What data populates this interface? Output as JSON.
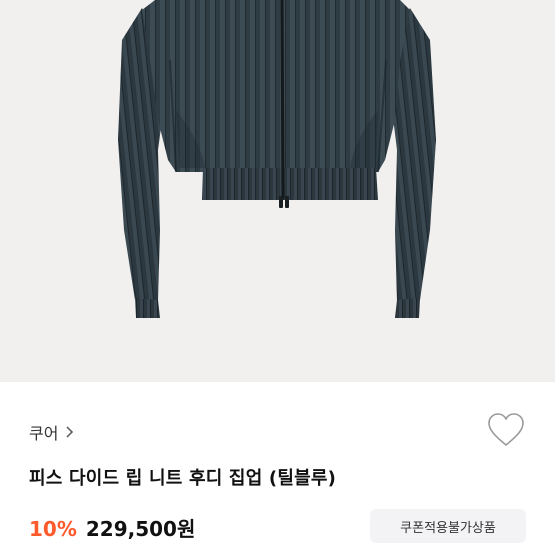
{
  "product": {
    "brand": "쿠어",
    "title": "피스 다이드 립 니트 후디 집업 (틸블루)",
    "discount": "10%",
    "price": "229,500원",
    "coupon_label": "쿠폰적용불가상품",
    "image_icon": "ribbed-knit-zipup-photo",
    "like_icon": "heart-outline-icon",
    "colors": {
      "discount": "#ff5a2c",
      "knit": "#2d3a42",
      "image_bg": "#f1f0ee"
    }
  }
}
